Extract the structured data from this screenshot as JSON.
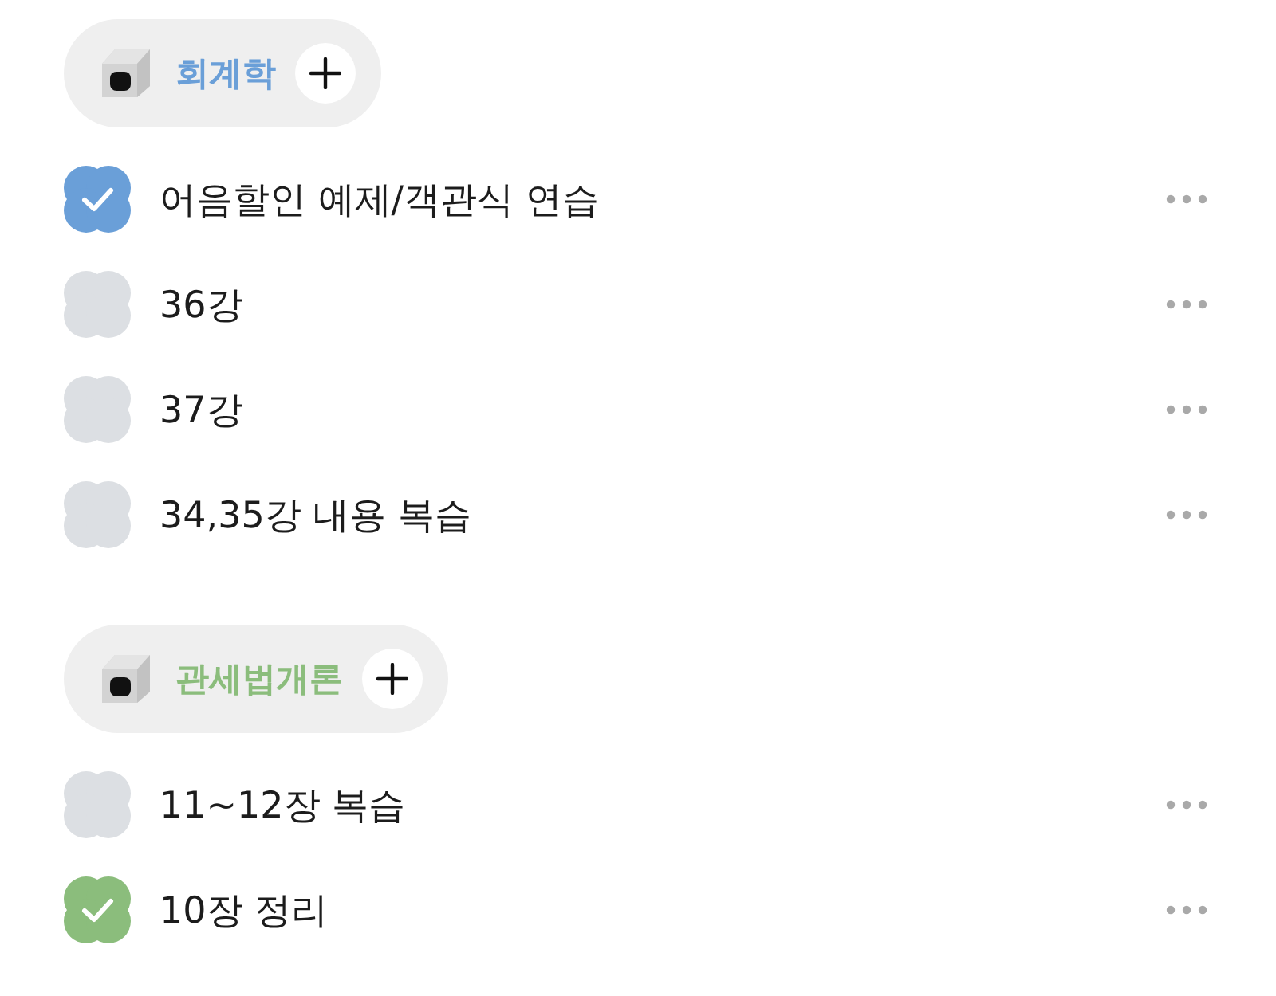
{
  "categories": [
    {
      "title": "회계학",
      "color": "#6a9fd8",
      "tasks": [
        {
          "label": "어음할인 예제/객관식 연습",
          "checked": true
        },
        {
          "label": "36강",
          "checked": false
        },
        {
          "label": "37강",
          "checked": false
        },
        {
          "label": "34,35강 내용 복습",
          "checked": false
        }
      ]
    },
    {
      "title": "관세법개론",
      "color": "#8bbd7c",
      "tasks": [
        {
          "label": "11~12장 복습",
          "checked": false
        },
        {
          "label": "10장 정리",
          "checked": true
        }
      ]
    }
  ]
}
